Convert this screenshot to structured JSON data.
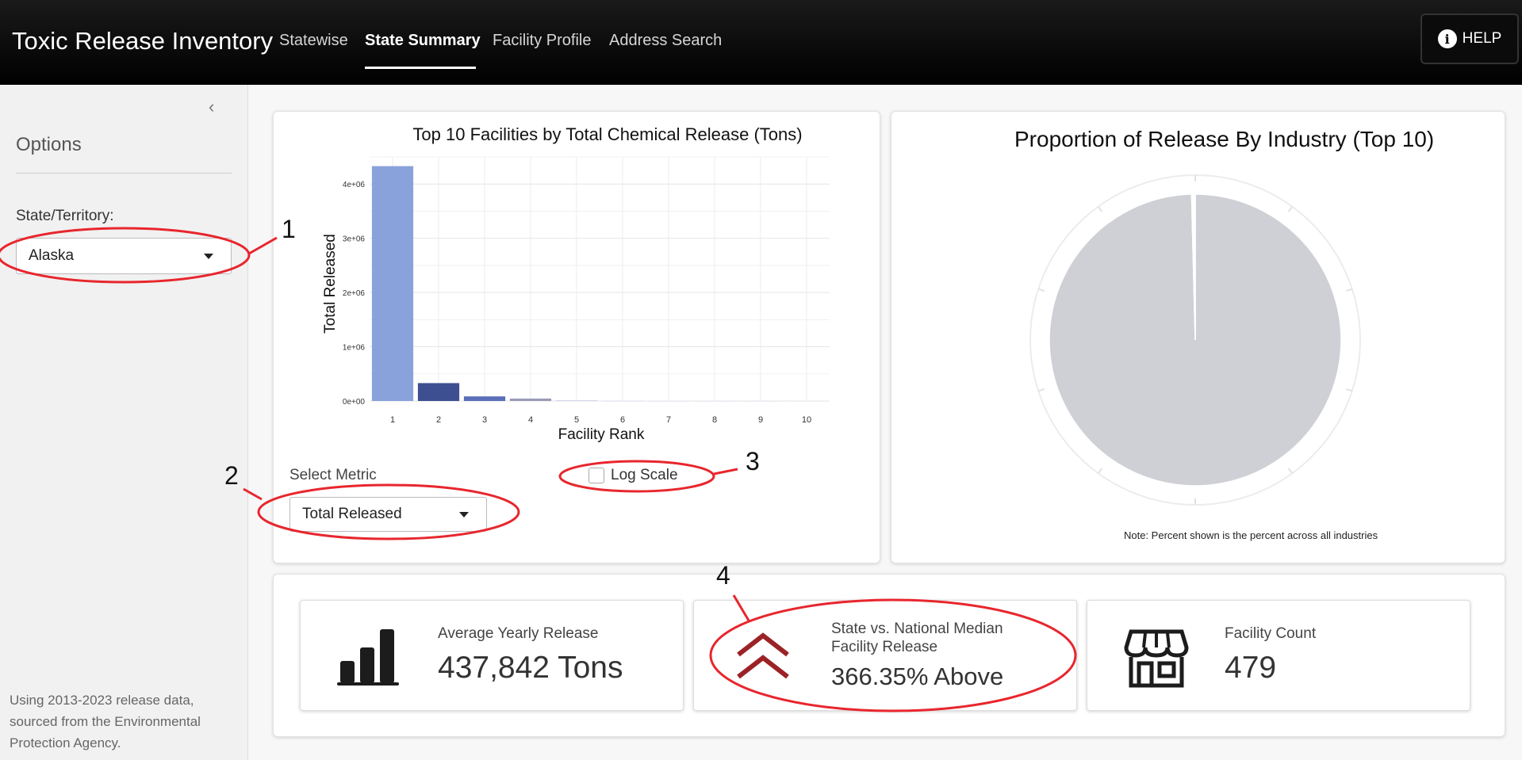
{
  "app": {
    "title": "Toxic Release Inventory",
    "nav": [
      "Statewise",
      "State Summary",
      "Facility Profile",
      "Address Search"
    ],
    "active_nav": "State Summary",
    "help_label": "HELP"
  },
  "sidebar": {
    "title": "Options",
    "state_label": "State/Territory:",
    "state_value": "Alaska",
    "footnote": "Using 2013-2023 release data, sourced from the Environmental Protection Agency."
  },
  "controls": {
    "metric_label": "Select Metric",
    "metric_value": "Total Released",
    "log_scale_label": "Log Scale",
    "log_scale_checked": false
  },
  "chart_data": [
    {
      "type": "bar",
      "title": "Top 10 Facilities by Total Chemical Release (Tons)",
      "xlabel": "Facility Rank",
      "ylabel": "Total Released",
      "categories": [
        "1",
        "2",
        "3",
        "4",
        "5",
        "6",
        "7",
        "8",
        "9",
        "10"
      ],
      "values": [
        4330000,
        330000,
        85000,
        45000,
        12000,
        3000,
        1500,
        800,
        400,
        200
      ],
      "ylim": [
        0,
        4500000
      ],
      "yticks": [
        0,
        1000000,
        2000000,
        3000000,
        4000000
      ],
      "ytick_labels": [
        "0e+00",
        "1e+06",
        "2e+06",
        "3e+06",
        "4e+06"
      ],
      "bar_colors": [
        "#8aa2db",
        "#3e4f91",
        "#5a6fb8",
        "#9a9bb8",
        "#c7cce6",
        "#d8dcef",
        "#dde0f0",
        "#e2e4f2",
        "#e6e8f4",
        "#eaebf5"
      ],
      "grid": true
    },
    {
      "type": "pie",
      "title": "Proportion of Release By Industry (Top 10)",
      "values": [
        99.6,
        0.4
      ],
      "colors": [
        "#cfd0d6",
        "#ffffff"
      ],
      "note": "Note: Percent shown is the percent across all industries"
    }
  ],
  "stats": [
    {
      "label": "Average Yearly Release",
      "value": "437,842 Tons",
      "icon": "bar-chart-icon"
    },
    {
      "label": "State vs. National Median Facility Release",
      "value": "366.35% Above",
      "icon": "chevron-up-double-icon"
    },
    {
      "label": "Facility Count",
      "value": "479",
      "icon": "storefront-icon"
    }
  ],
  "annotations": [
    "1",
    "2",
    "3",
    "4"
  ],
  "colors": {
    "annotation": "#e8262d",
    "chevron": "#9b2226",
    "bar_primary": "#8aa2db"
  }
}
